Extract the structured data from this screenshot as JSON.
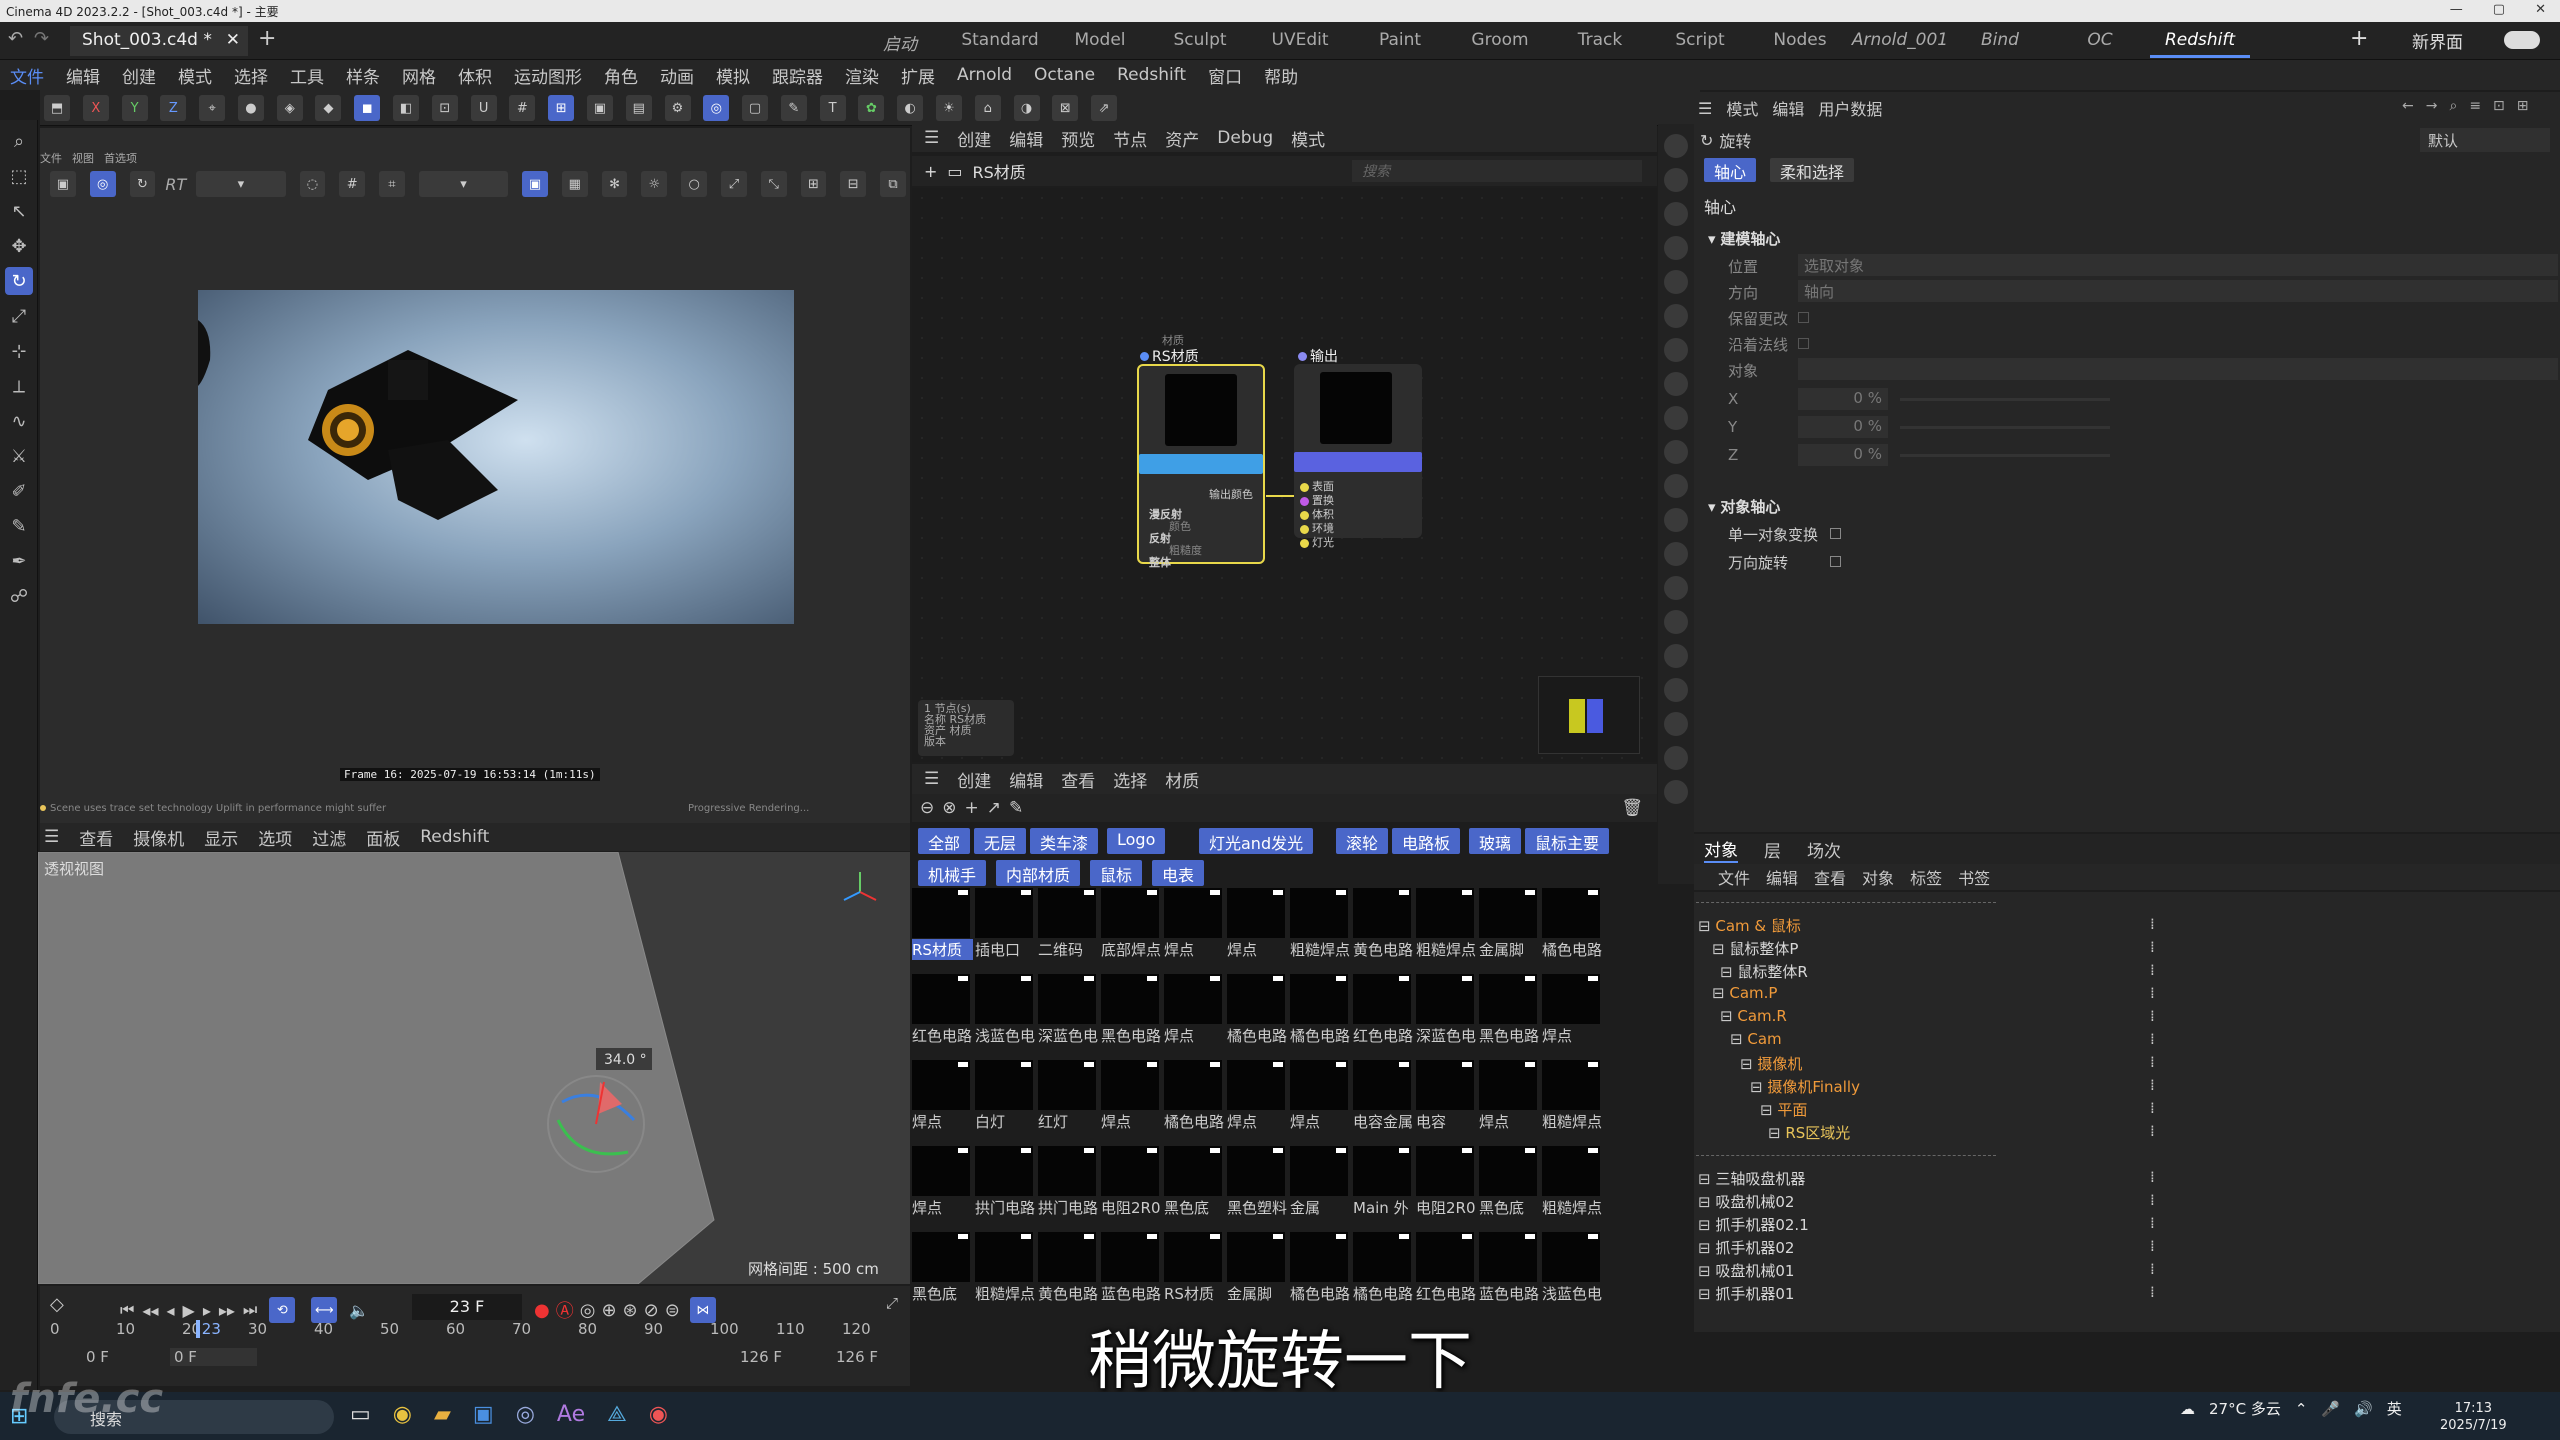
{
  "window": {
    "title": "Cinema 4D 2023.2.2 - [Shot_003.c4d *] - 主要"
  },
  "doc_tab": {
    "label": "Shot_003.c4d *"
  },
  "layouts": [
    {
      "label": "启动",
      "style": "it"
    },
    {
      "label": "Standard",
      "style": ""
    },
    {
      "label": "Model",
      "style": ""
    },
    {
      "label": "Sculpt",
      "style": ""
    },
    {
      "label": "UVEdit",
      "style": ""
    },
    {
      "label": "Paint",
      "style": ""
    },
    {
      "label": "Groom",
      "style": ""
    },
    {
      "label": "Track",
      "style": ""
    },
    {
      "label": "Script",
      "style": ""
    },
    {
      "label": "Nodes",
      "style": ""
    },
    {
      "label": "Arnold_001",
      "style": "it"
    },
    {
      "label": "Bind",
      "style": "it"
    },
    {
      "label": "OC",
      "style": "it"
    },
    {
      "label": "Redshift",
      "style": "it act"
    }
  ],
  "new_ui_label": "新界面",
  "menus": [
    "文件",
    "编辑",
    "创建",
    "模式",
    "选择",
    "工具",
    "样条",
    "网格",
    "体积",
    "运动图形",
    "角色",
    "动画",
    "模拟",
    "跟踪器",
    "渲染",
    "扩展",
    "Arnold",
    "Octane",
    "Redshift",
    "窗口",
    "帮助"
  ],
  "renderview": {
    "menu": [
      "文件",
      "视图",
      "首选项"
    ],
    "rt_label": "RT",
    "frame_label": "Frame  16:  2025-07-19  16:53:14  (1m:11s)",
    "status_left": "Scene uses trace set technology   Uplift in performance might suffer",
    "status_right": "Progressive Rendering..."
  },
  "viewport": {
    "menu": [
      "查看",
      "摄像机",
      "显示",
      "选项",
      "过滤",
      "面板",
      "Redshift"
    ],
    "label": "透视视图",
    "grid_label": "网格间距 : 500 cm",
    "angle_label": "34.0 °"
  },
  "timeline": {
    "current_frame": "23 F",
    "ruler": [
      "0",
      "10",
      "20",
      "23",
      "30",
      "40",
      "50",
      "60",
      "70",
      "80",
      "90",
      "100",
      "110",
      "120"
    ],
    "range_start": "0 F",
    "range_start2": "0 F",
    "range_end": "126 F",
    "range_end2": "126 F"
  },
  "node_editor": {
    "menu": [
      "创建",
      "编辑",
      "预览",
      "节点",
      "资产",
      "Debug",
      "模式"
    ],
    "breadcrumb": "RS材质",
    "search_placeholder": "搜索",
    "node1": {
      "group": "材质",
      "title": "RS材质",
      "out": "输出颜色",
      "ports": [
        "漫反射",
        "颜色",
        "反射",
        "粗糙度",
        "整体"
      ]
    },
    "node2": {
      "title": "输出",
      "ports": [
        "表面",
        "置换",
        "体积",
        "环境",
        "灯光"
      ]
    },
    "info": [
      "1 节点(s)",
      "名称    RS材质",
      "资产    材质",
      "版本"
    ]
  },
  "material_manager": {
    "menu": [
      "创建",
      "编辑",
      "查看",
      "选择",
      "材质"
    ],
    "filters_row1": [
      "全部",
      "无层",
      "类车漆",
      "Logo",
      "灯光and发光",
      "滚轮",
      "电路板",
      "玻璃",
      "鼠标主要"
    ],
    "filters_row2": [
      "机械手",
      "内部材质",
      "鼠标",
      "电表"
    ],
    "materials": [
      "RS材质",
      "插电口",
      "二维码",
      "底部焊点",
      "焊点",
      "焊点",
      "粗糙焊点",
      "黄色电路",
      "粗糙焊点",
      "金属脚",
      "橘色电路",
      "红色电路",
      "浅蓝色电",
      "深蓝色电",
      "黑色电路",
      "焊点",
      "橘色电路",
      "橘色电路",
      "红色电路",
      "深蓝色电",
      "黑色电路",
      "焊点",
      "焊点",
      "白灯",
      "红灯",
      "焊点",
      "橘色电路",
      "焊点",
      "焊点",
      "电容金属",
      "电容",
      "焊点",
      "粗糙焊点",
      "焊点",
      "拱门电路",
      "拱门电路",
      "电阻2R0",
      "黑色底",
      "黑色塑料",
      "金属",
      "Main 外",
      "电阻2R0",
      "黑色底",
      "粗糙焊点",
      "黑色底",
      "粗糙焊点",
      "黄色电路",
      "蓝色电路",
      "RS材质",
      "金属脚",
      "橘色电路",
      "橘色电路",
      "红色电路",
      "蓝色电路",
      "浅蓝色电"
    ]
  },
  "attributes": {
    "menu": [
      "模式",
      "编辑",
      "用户数据"
    ],
    "mode_label": "旋转",
    "preset": "默认",
    "tab_active": "轴心",
    "tab_other": "柔和选择",
    "section_title": "轴心",
    "group1": "建模轴心",
    "pos_label": "位置",
    "pos_value": "选取对象",
    "dir_label": "方向",
    "dir_value": "轴向",
    "keep_label": "保留更改",
    "normal_label": "沿着法线",
    "object_label": "对象",
    "x_label": "X",
    "x_value": "0 %",
    "y_label": "Y",
    "y_value": "0 %",
    "z_label": "Z",
    "z_value": "0 %",
    "group2": "对象轴心",
    "single_label": "单一对象变换",
    "gimbal_label": "万向旋转"
  },
  "object_manager": {
    "tabs": [
      "对象",
      "层",
      "场次"
    ],
    "menu": [
      "文件",
      "编辑",
      "查看",
      "对象",
      "标签",
      "书签"
    ],
    "objects": [
      {
        "label": "",
        "color": "w"
      },
      {
        "label": "Cam & 鼠标",
        "color": "o"
      },
      {
        "label": "鼠标整体P",
        "color": "w"
      },
      {
        "label": "鼠标整体R",
        "color": "w"
      },
      {
        "label": "Cam.P",
        "color": "o"
      },
      {
        "label": "Cam.R",
        "color": "o"
      },
      {
        "label": "Cam",
        "color": "o"
      },
      {
        "label": "摄像机",
        "color": "o"
      },
      {
        "label": "摄像机Finally",
        "color": "o"
      },
      {
        "label": "平面",
        "color": "o"
      },
      {
        "label": "RS区域光",
        "color": "y"
      },
      {
        "label": "",
        "color": "w"
      },
      {
        "label": "三轴吸盘机器",
        "color": "w"
      },
      {
        "label": "吸盘机械02",
        "color": "w"
      },
      {
        "label": "抓手机器02.1",
        "color": "w"
      },
      {
        "label": "抓手机器02",
        "color": "w"
      },
      {
        "label": "吸盘机械01",
        "color": "w"
      },
      {
        "label": "抓手机器01",
        "color": "w"
      }
    ]
  },
  "subtitle": "稍微旋转一下",
  "taskbar": {
    "search": "搜索",
    "weather": "27°C 多云",
    "ime": "英",
    "time": "17:13",
    "date": "2025/7/19"
  },
  "watermark": "fnfe.cc",
  "colors": {
    "accent": "#4a67c9",
    "orange": "#f09a3a",
    "node_sel": "#e8d84a"
  }
}
